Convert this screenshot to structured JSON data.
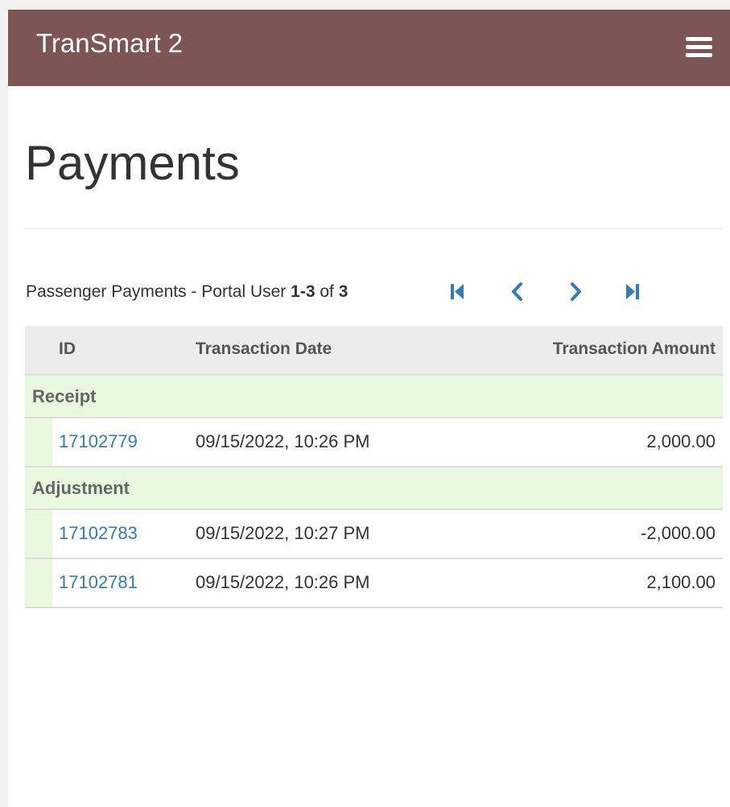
{
  "app": {
    "brand": "TranSmart 2",
    "menu_icon": "hamburger-menu-icon",
    "header_color": "#7d5555"
  },
  "page": {
    "title": "Payments"
  },
  "list": {
    "title_prefix": "Passenger Payments - Portal User ",
    "range": "1-3",
    "of_text": " of ",
    "total": "3",
    "pager": {
      "first_icon": "first-page-icon",
      "prev_icon": "chevron-left-icon",
      "next_icon": "chevron-right-icon",
      "last_icon": "last-page-icon",
      "icon_color": "#337ab7"
    }
  },
  "table": {
    "columns": [
      "ID",
      "Transaction Date",
      "Transaction Amount"
    ],
    "group_color": "#e8f8df",
    "link_color": "#337ab7",
    "groups": [
      {
        "label": "Receipt",
        "rows": [
          {
            "id": "17102779",
            "date": "09/15/2022, 10:26 PM",
            "amount": "2,000.00"
          }
        ]
      },
      {
        "label": "Adjustment",
        "rows": [
          {
            "id": "17102783",
            "date": "09/15/2022, 10:27 PM",
            "amount": "-2,000.00"
          },
          {
            "id": "17102781",
            "date": "09/15/2022, 10:26 PM",
            "amount": "2,100.00"
          }
        ]
      }
    ]
  }
}
